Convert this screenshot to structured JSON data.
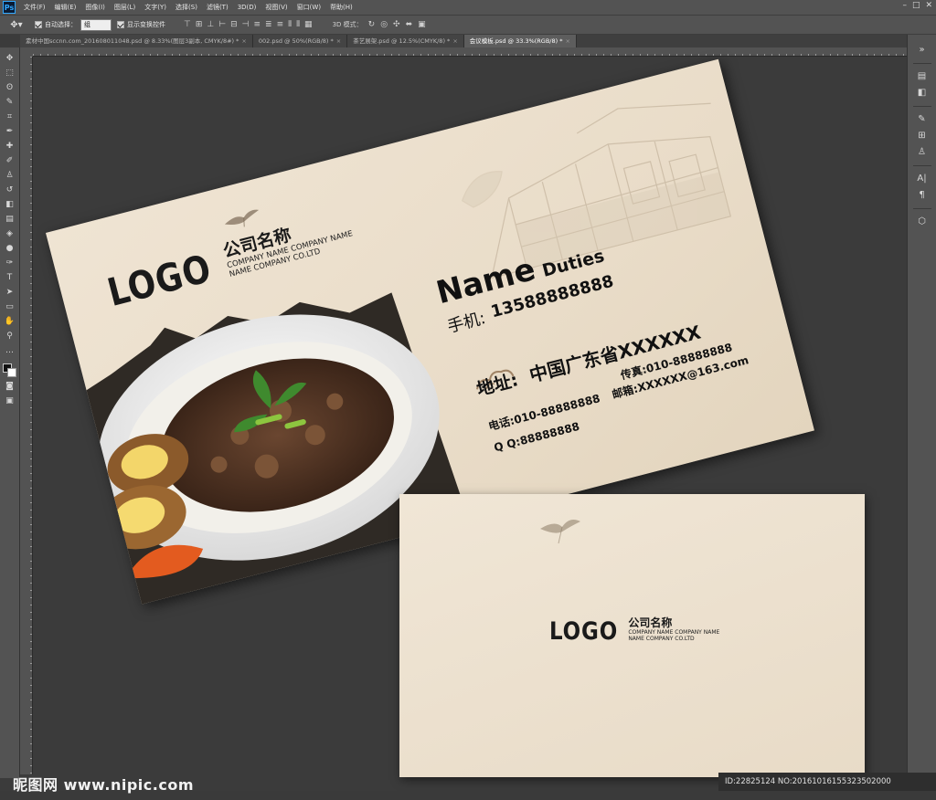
{
  "menubar": {
    "app_logo": "Ps",
    "items": [
      "文件(F)",
      "编辑(E)",
      "图像(I)",
      "图层(L)",
      "文字(Y)",
      "选择(S)",
      "滤镜(T)",
      "3D(D)",
      "视图(V)",
      "窗口(W)",
      "帮助(H)"
    ]
  },
  "options": {
    "auto_select_label": "自动选择：",
    "auto_select_value": "组",
    "show_transform_label": "显示变换控件",
    "mode_3d_label": "3D 模式："
  },
  "tabs": [
    {
      "label": "素材中国sccnn.com_201608011048.psd @ 8.33%(图层3副本, CMYK/8#) *",
      "active": false
    },
    {
      "label": "002.psd @ 50%(RGB/8) *",
      "active": false
    },
    {
      "label": "茶艺展架.psd @ 12.5%(CMYK/8) *",
      "active": false
    },
    {
      "label": "会议模板.psd @ 33.3%(RGB/8) *",
      "active": true
    }
  ],
  "card_front": {
    "logo": "LOGO",
    "company_cn": "公司名称",
    "company_en_1": "COMPANY NAME COMPANY NAME",
    "company_en_2": "NAME COMPANY CO.LTD",
    "name": "Name",
    "duties": "Duties",
    "mobile_label": "手机:",
    "mobile_value": "13588888888",
    "address_label": "地址:",
    "address_value": "中国广东省XXXXXX",
    "phone": "电话:010-88888888",
    "fax": "传真:010-88888888",
    "email": "邮箱:XXXXXX@163.com",
    "qq": "Q Q:88888888"
  },
  "card_back": {
    "logo": "LOGO",
    "company_cn": "公司名称",
    "company_en_1": "COMPANY NAME COMPANY NAME",
    "company_en_2": "NAME COMPANY CO.LTD"
  },
  "watermark": "昵图网 www.nipic.com",
  "image_id": "ID:22825124 NO:20161016155323502000",
  "colors": {
    "canvas_bg": "#3b3b3b",
    "card_paper": "#ece0cd",
    "ui_panel": "#535353"
  }
}
